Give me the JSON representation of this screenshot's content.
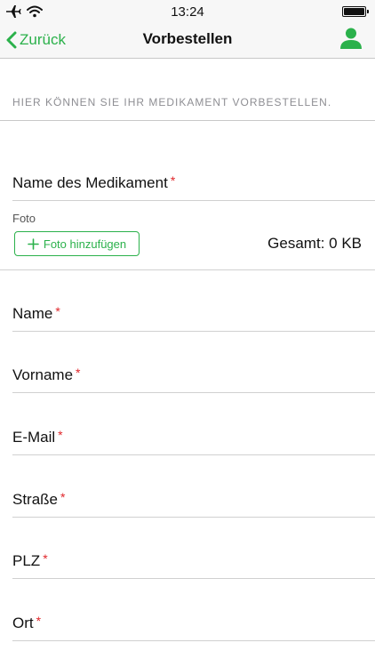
{
  "status_bar": {
    "time": "13:24",
    "icons": [
      "airplane-icon",
      "wifi-icon",
      "battery-icon"
    ]
  },
  "nav": {
    "back_label": "Zurück",
    "title": "Vorbestellen",
    "profile_icon": "person-icon"
  },
  "section": {
    "header": "HIER KÖNNEN SIE IHR MEDIKAMENT VORBESTELLEN."
  },
  "form": {
    "medication_label": "Name des Medikament",
    "required_marker": "*",
    "photo": {
      "label": "Foto",
      "add_button_label": "Foto hinzufügen",
      "add_button_icon": "plus-icon",
      "total_label": "Gesamt: 0 KB"
    },
    "fields": [
      {
        "label": "Name"
      },
      {
        "label": "Vorname"
      },
      {
        "label": "E-Mail"
      },
      {
        "label": "Straße"
      },
      {
        "label": "PLZ"
      },
      {
        "label": "Ort"
      }
    ]
  },
  "colors": {
    "accent": "#2bb14b",
    "required": "#e0262a",
    "section_text": "#8e8e93",
    "bar_background": "#f7f7f7"
  }
}
